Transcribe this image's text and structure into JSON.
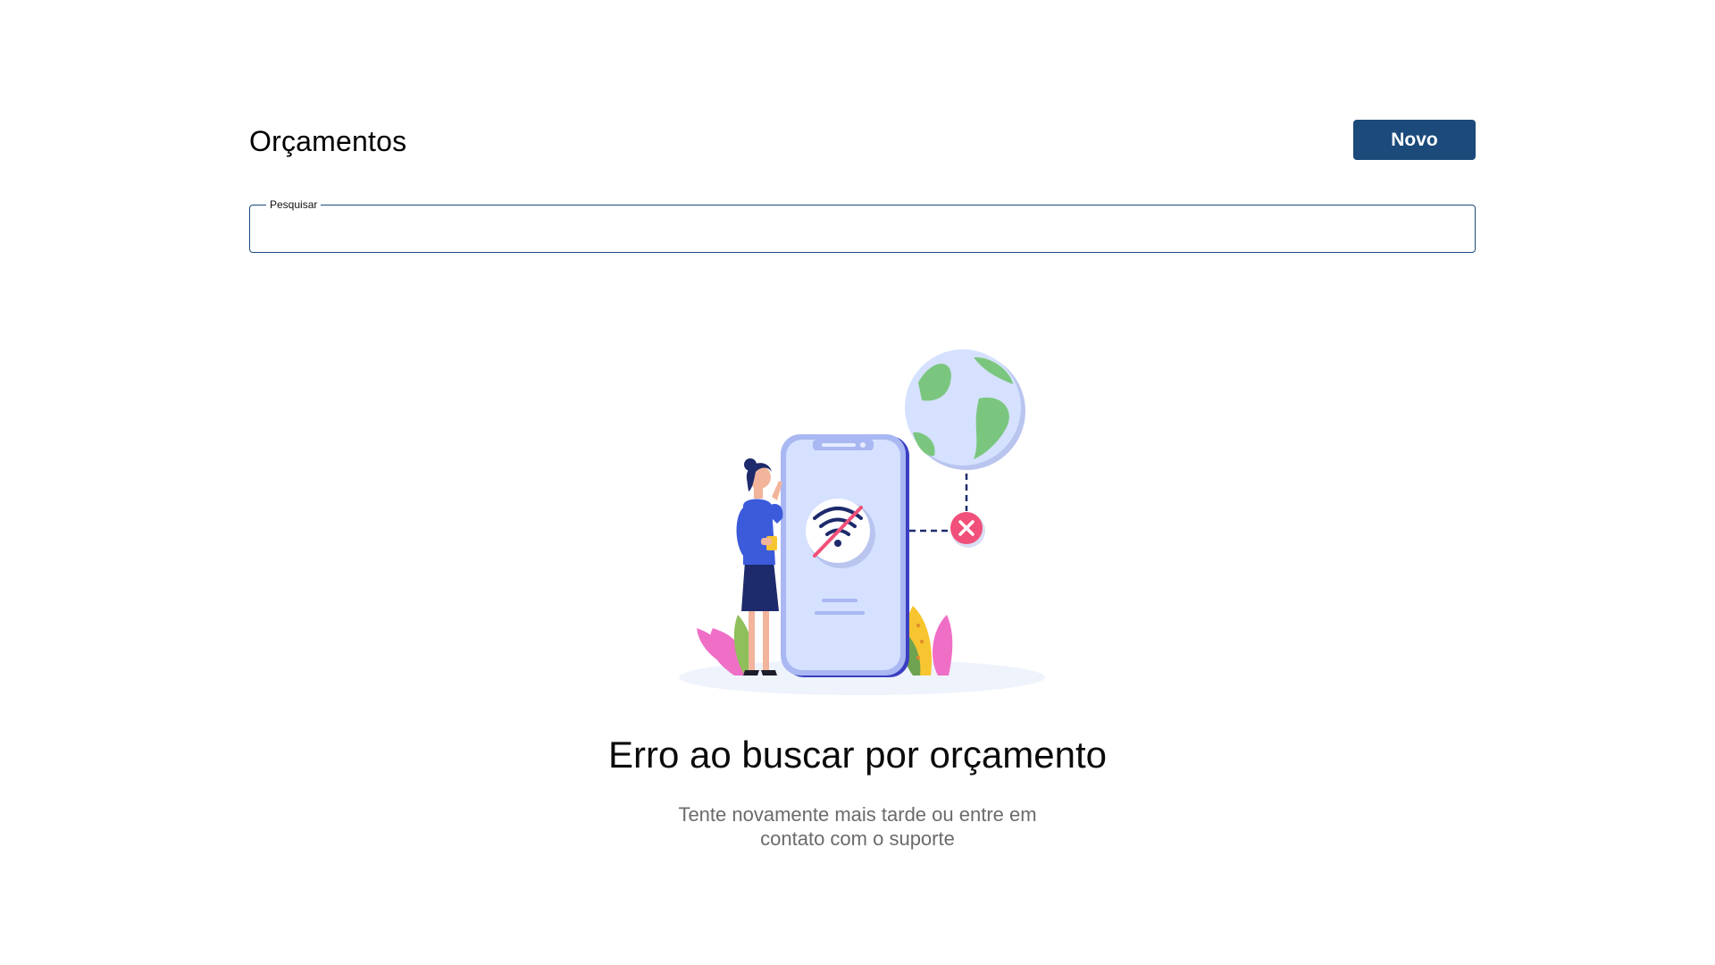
{
  "header": {
    "title": "Orçamentos",
    "new_button_label": "Novo"
  },
  "search": {
    "label": "Pesquisar",
    "value": ""
  },
  "empty_state": {
    "illustration_icon": "no-connection-illustration",
    "title": "Erro ao buscar por orçamento",
    "message_line1": "Tente novamente mais tarde ou entre em",
    "message_line2": "contato com o suporte"
  },
  "colors": {
    "primary": "#1b4a7b",
    "error_accent": "#f0507a",
    "muted_text": "#6b6b6b"
  }
}
